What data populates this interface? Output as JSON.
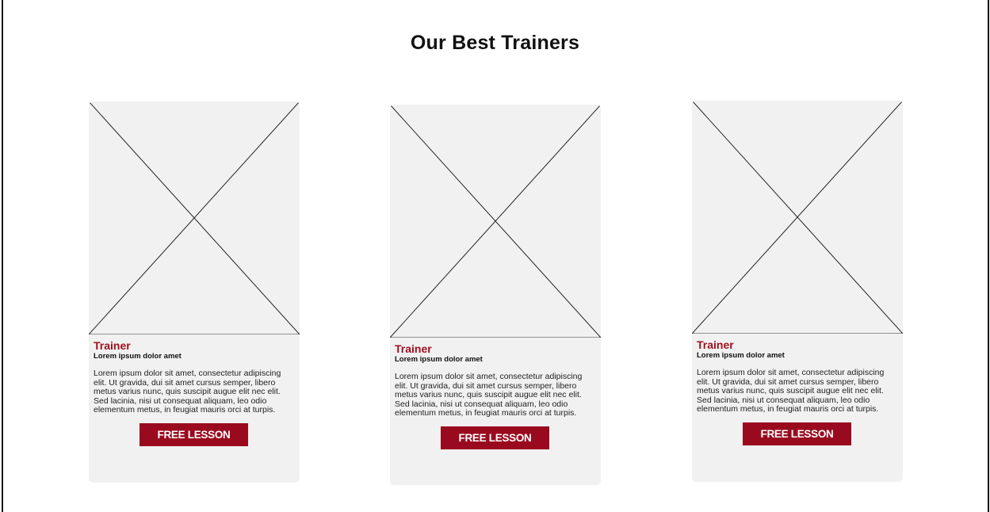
{
  "section": {
    "title": "Our Best Trainers"
  },
  "trainers": [
    {
      "role": "Trainer",
      "subtitle": "Lorem ipsum dolor amet",
      "description": "Lorem ipsum dolor sit amet, consectetur adipiscing elit. Ut gravida, dui sit amet cursus semper, libero metus varius nunc, quis suscipit augue elit nec elit. Sed lacinia, nisi ut consequat aliquam, leo odio elementum metus, in feugiat mauris orci at turpis.",
      "cta_label": "FREE LESSON"
    },
    {
      "role": "Trainer",
      "subtitle": "Lorem ipsum dolor amet",
      "description": "Lorem ipsum dolor sit amet, consectetur adipiscing elit. Ut gravida, dui sit amet cursus semper, libero metus varius nunc, quis suscipit augue elit nec elit. Sed lacinia, nisi ut consequat aliquam, leo odio elementum metus, in feugiat mauris orci at turpis.",
      "cta_label": "FREE LESSON"
    },
    {
      "role": "Trainer",
      "subtitle": "Lorem ipsum dolor amet",
      "description": "Lorem ipsum dolor sit amet, consectetur adipiscing elit. Ut gravida, dui sit amet cursus semper, libero metus varius nunc, quis suscipit augue elit nec elit. Sed lacinia, nisi ut consequat aliquam, leo odio elementum metus, in feugiat mauris orci at turpis.",
      "cta_label": "FREE LESSON"
    }
  ],
  "colors": {
    "accent": "#9a0a1e",
    "role_text": "#a0101f",
    "card_background": "#f1f1f1"
  },
  "icons": {
    "photo_placeholder": "image-placeholder-icon"
  }
}
